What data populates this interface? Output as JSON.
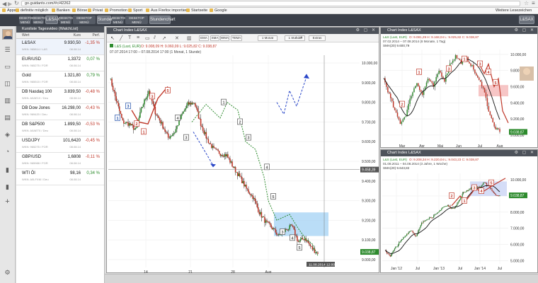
{
  "browser": {
    "url": "go.guidants.com/#c/42262",
    "bookmarks": [
      "Apps",
      "definitiv möglich",
      "Banken",
      "Börse",
      "Privat",
      "Promotion",
      "Sport",
      "Aus Firefox importiert",
      "Startseite",
      "Google"
    ],
    "other_bookmarks": "Weitere Lesezeichen"
  },
  "toolbar": {
    "buttons": [
      "DESKTOP MENÜ",
      "DESKTOP MENÜ",
      "L&SAX",
      "DESKTOP MENÜ",
      "DESKTOP MENÜ",
      "Stundenchart",
      "DESKTOP MENÜ",
      "DESKTOP MENÜ",
      "Stundenchart"
    ],
    "right_button": "L&SAX",
    "colors": {
      "bar": "#3b4049",
      "button": "#565c66"
    }
  },
  "rail": {
    "icons": [
      "avatar",
      "list-icon",
      "monitor-icon",
      "layers-icon",
      "chart-icon",
      "briefcase-icon",
      "tag-icon",
      "gauge-icon",
      "bookmark-icon",
      "bookmark-icon",
      "plus-icon",
      "gear-icon"
    ]
  },
  "watchlist": {
    "title": "Kursliste Tagesvideo (WatchList)",
    "col_name": "Wert",
    "col_price": "Kurs",
    "col_change": "Perf.",
    "rows": [
      {
        "name": "L&SAX",
        "sub": "WKN: 965814 / L&S",
        "price": "9.930,50",
        "time": "08.08.14",
        "change": "-1,35 %",
        "dir": "neg"
      },
      {
        "name": "EUR/USD",
        "sub": "WKN: 965275 / FOR",
        "price": "1,3372",
        "time": "08.08.14",
        "change": "0,07 %",
        "dir": "pos"
      },
      {
        "name": "Gold",
        "sub": "WKN: 965515 / FOR",
        "price": "1.321,80",
        "time": "08.08.14",
        "change": "0,79 %",
        "dir": "pos"
      },
      {
        "name": "DB Nasdaq 100",
        "sub": "WKN: A0AE1X / Deu",
        "price": "3.839,50",
        "time": "08.08.14",
        "change": "-0,48 %",
        "dir": "neg"
      },
      {
        "name": "DB Dow Jones",
        "sub": "WKN: 969420 / Deu",
        "price": "16.298,00",
        "time": "08.08.14",
        "change": "-0,43 %",
        "dir": "neg"
      },
      {
        "name": "DB S&P500",
        "sub": "WKN: A0AET0 / Deu",
        "price": "1.899,50",
        "time": "08.08.14",
        "change": "-0,53 %",
        "dir": "neg"
      },
      {
        "name": "USD/JPY",
        "sub": "WKN: 965275 / FOR",
        "price": "101,6420",
        "time": "08.08.14",
        "change": "-0,45 %",
        "dir": "neg"
      },
      {
        "name": "GBP/USD",
        "sub": "WKN: 965988 / FOR",
        "price": "1,6808",
        "time": "08.08.14",
        "change": "-0,11 %",
        "dir": "neg"
      },
      {
        "name": "WTI Öl",
        "sub": "WKN: A0LFXM / Deu",
        "price": "98,16",
        "time": "08.08.14",
        "change": "0,34 %",
        "dir": "pos"
      }
    ]
  },
  "main_chart": {
    "title": "Chart Index L&SAX",
    "toolbar": [
      "EMA",
      "SMA",
      "WMA",
      "TEMA",
      "1 Monat",
      "1 Stunde",
      "Extras"
    ],
    "ohlc": "O: 9.008,09  H: 9.060,09  L: 9.025,82  C: 9.038,87",
    "info_label": "L&S (Last, EUR)",
    "range": "07.07.2014 17:00 – 07.08.2014 17:00 (1 Monat, 1 Stunde)",
    "y_ticks": [
      "10.000,00",
      "9.900,00",
      "9.800,00",
      "9.700,00",
      "9.600,00",
      "9.500,00",
      "9.400,00",
      "9.300,00",
      "9.200,00",
      "9.100,00",
      "9.000,00"
    ],
    "x_ticks": [
      "14",
      "21",
      "28",
      "Aug"
    ],
    "crosshair_price": "9.458,39",
    "last_price": "9.038,87",
    "crosshair_time": "11.08.2014 12:00",
    "colors": {
      "up": "#2e8b2e",
      "down": "#c0392b",
      "zone": "#a9d5f5",
      "projection": "#2a47c8"
    }
  },
  "right_top": {
    "title": "Chart Index L&SAX",
    "ohlc": "O: 9.081,29  H: 9.168,04  L: 9.025,82  C: 9.038,87",
    "info_label": "L&S (Last, EUR)",
    "range": "07.02.2014 – 07.08.2014 (6 Monate, 1 Tag)",
    "sma": "SMA(20)  9.600,79",
    "y_ticks": [
      "10.000,00",
      "9.800,00",
      "9.600,00",
      "9.400,00",
      "9.200,00",
      "9.000,00"
    ],
    "x_ticks": [
      "Mar",
      "Apr",
      "Mai",
      "Jun",
      "Jul",
      "Aug"
    ],
    "last_price": "9.038,87"
  },
  "right_bottom": {
    "title": "Chart Index L&SAX",
    "ohlc": "O: 9.208,34  H: 9.220,04  L: 9.043,23  C: 9.038,87",
    "info_label": "L&S (Last, EUR)",
    "range": "01.08.2011 – 04.08.2014 (3 Jahre, 1 Woche)",
    "sma": "SMA(20)  9.643,82",
    "y_ticks": [
      "10.000,00",
      "9.000,00",
      "8.000,00",
      "7.000,00",
      "6.000,00",
      "5.000,00"
    ],
    "x_ticks": [
      "Jan '12",
      "Jul",
      "Jan '13",
      "Jul",
      "Jan '14",
      "Jul"
    ],
    "last_price": "9.038,87"
  }
}
